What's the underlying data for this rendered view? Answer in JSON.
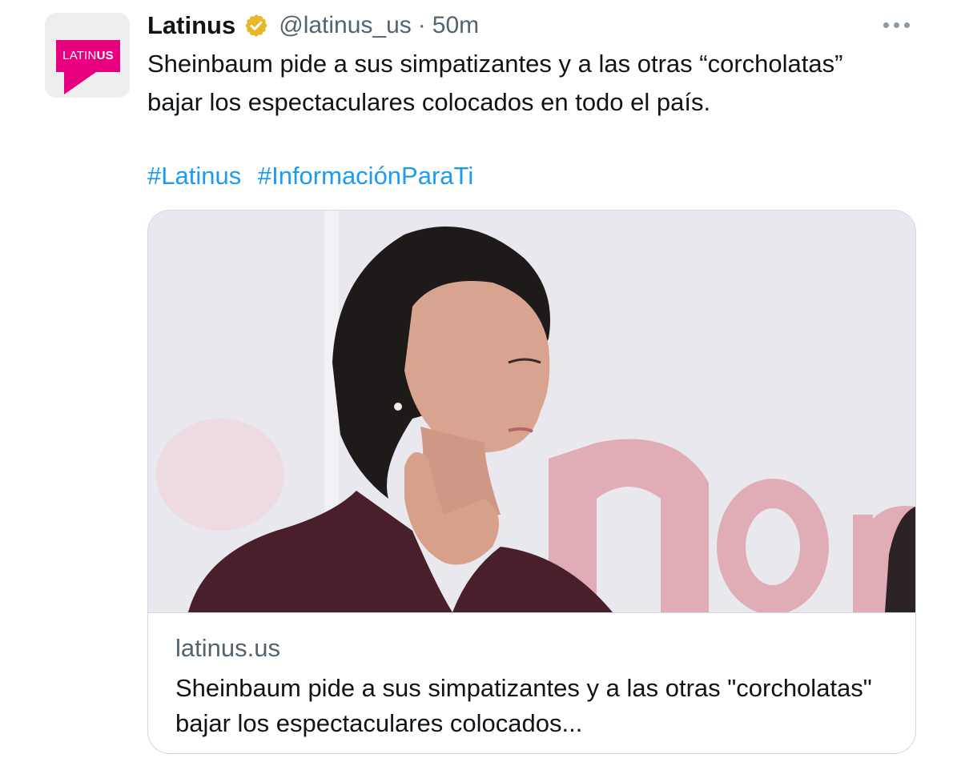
{
  "account": {
    "name": "Latinus",
    "handle": "@latinus_us",
    "separator": "·",
    "time": "50m",
    "avatar_logo": {
      "text_regular": "LATIN",
      "text_bold": "US",
      "color": "#e6007e"
    },
    "verified_icon": "verified-badge-gold"
  },
  "tweet": {
    "text": "Sheinbaum pide a sus simpatizantes y a las otras “corcholatas” bajar los espectaculares colocados en todo el país.",
    "hashtags": [
      "#Latinus",
      "#InformaciónParaTi"
    ]
  },
  "card": {
    "domain": "latinus.us",
    "title": "Sheinbaum pide a sus simpatizantes y a las otras \"corcholatas\" bajar los espectaculares colocados..."
  },
  "colors": {
    "link": "#1d9bf0",
    "secondary_text": "#536471",
    "border": "#cfd9de",
    "verified": "#e8b829"
  },
  "icons": {
    "more": "more-horizontal-icon"
  }
}
